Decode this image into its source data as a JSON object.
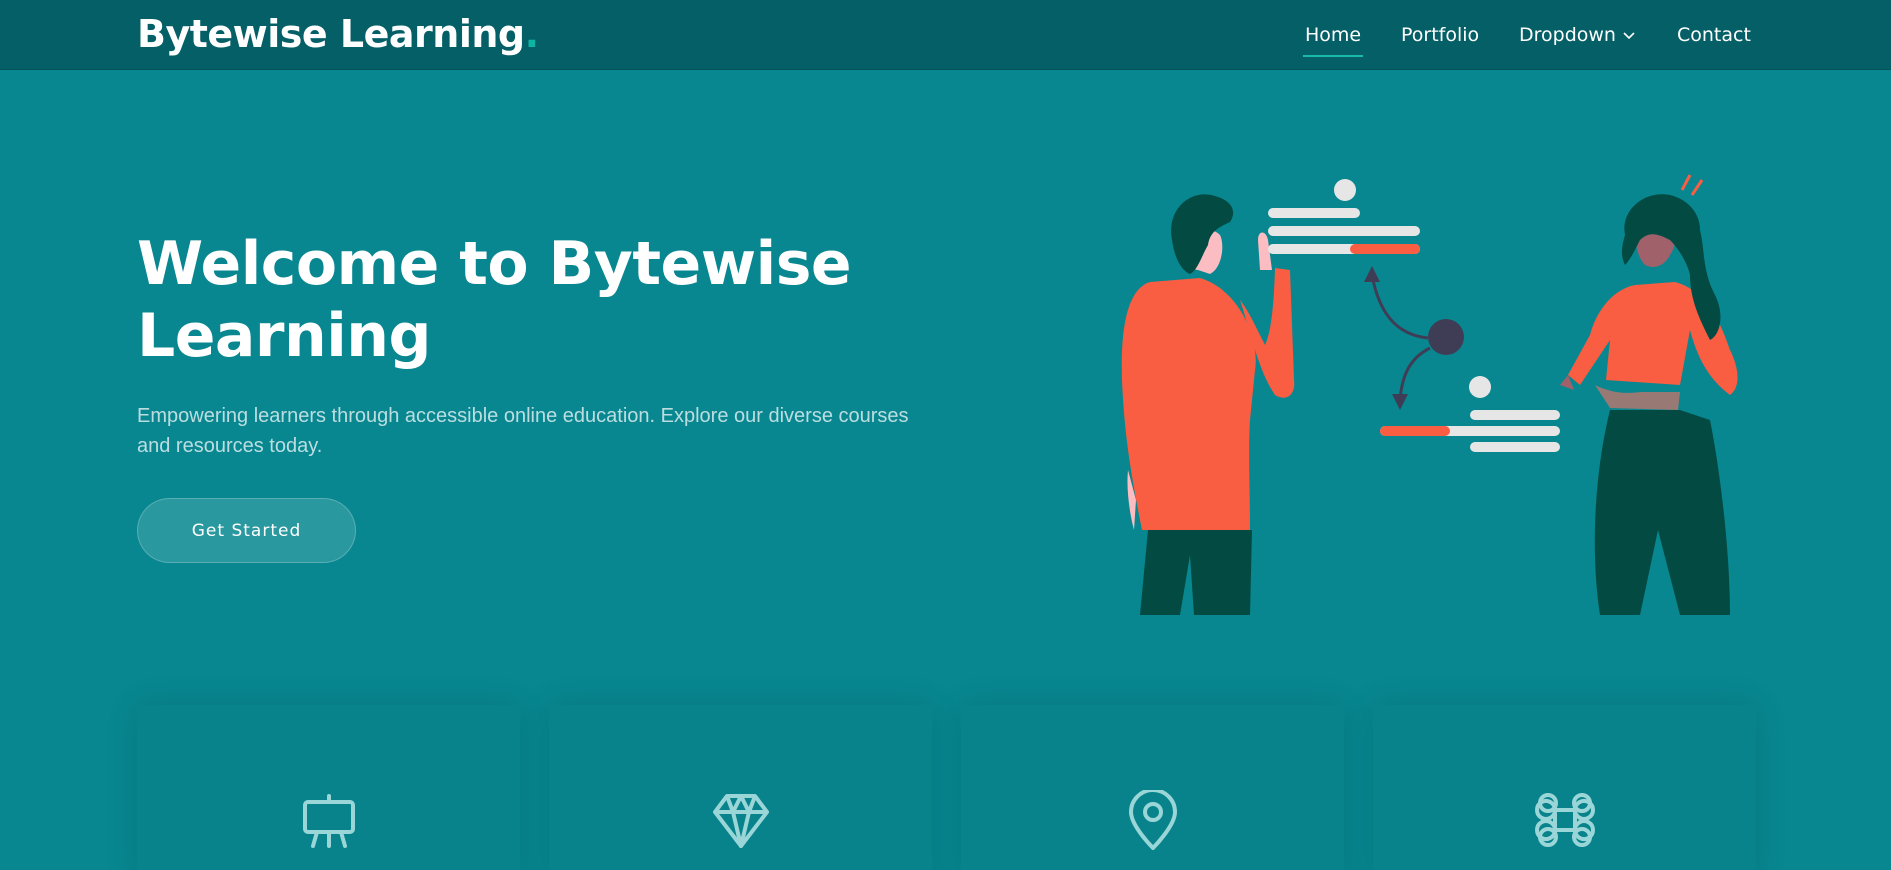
{
  "brand": {
    "name": "Bytewise Learning",
    "dot": "."
  },
  "nav": {
    "items": [
      {
        "label": "Home",
        "active": true
      },
      {
        "label": "Portfolio"
      },
      {
        "label": "Dropdown",
        "icon": "chevron-down-icon"
      },
      {
        "label": "Contact"
      }
    ]
  },
  "hero": {
    "title": "Welcome to Bytewise Learning",
    "subtitle": "Empowering learners through accessible online education. Explore our diverse courses and resources today.",
    "cta_label": "Get Started"
  },
  "features": [
    {
      "icon": "easel-icon"
    },
    {
      "icon": "gem-icon"
    },
    {
      "icon": "location-pin-icon"
    },
    {
      "icon": "command-icon"
    }
  ],
  "colors": {
    "background": "#088790",
    "header": "#045f66",
    "accent": "#18b9a8",
    "illustration_orange": "#f95e42",
    "illustration_dark": "#034a42"
  }
}
